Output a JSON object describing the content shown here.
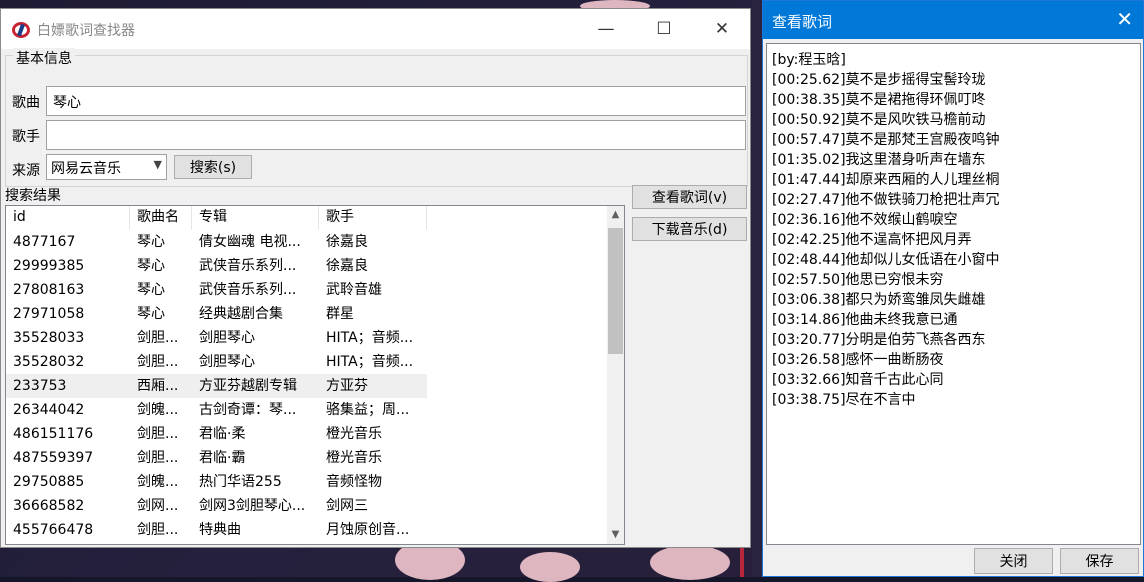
{
  "main_window": {
    "title": "白嫖歌词查找器",
    "controls": {
      "minimize": "—",
      "maximize": "☐",
      "close": "✕"
    }
  },
  "basic_info": {
    "legend": "基本信息",
    "song_label": "歌曲",
    "song_value": "琴心",
    "singer_label": "歌手",
    "singer_value": "",
    "source_label": "来源",
    "source_value": "网易云音乐",
    "search_button": "搜索(s)"
  },
  "results": {
    "label": "搜索结果",
    "columns": [
      "id",
      "歌曲名",
      "专辑",
      "歌手"
    ],
    "rows": [
      [
        "4877167",
        "琴心",
        "倩女幽魂 电视...",
        "徐嘉良"
      ],
      [
        "29999385",
        "琴心",
        "武侠音乐系列...",
        "徐嘉良"
      ],
      [
        "27808163",
        "琴心",
        "武侠音乐系列...",
        "武聆音雄"
      ],
      [
        "27971058",
        "琴心",
        "经典越剧合集",
        "群星"
      ],
      [
        "35528033",
        "剑胆...",
        "剑胆琴心",
        "HITA；音频..."
      ],
      [
        "35528032",
        "剑胆...",
        "剑胆琴心",
        "HITA；音频..."
      ],
      [
        "233753",
        "西厢...",
        "方亚芬越剧专辑",
        "方亚芬"
      ],
      [
        "26344042",
        "剑魄...",
        "古剑奇谭：琴...",
        "骆集益；周..."
      ],
      [
        "486151176",
        "剑胆...",
        "君临·柔",
        "橙光音乐"
      ],
      [
        "487559397",
        "剑胆...",
        "君临·霸",
        "橙光音乐"
      ],
      [
        "29750885",
        "剑魄...",
        "热门华语255",
        "音频怪物"
      ],
      [
        "36668582",
        "剑网...",
        "剑网3剑胆琴心...",
        "剑网三"
      ],
      [
        "455766478",
        "剑胆...",
        "特典曲",
        "月蚀原创音..."
      ]
    ],
    "selected_row": 6
  },
  "side_buttons": {
    "view_lyrics": "查看歌词(v)",
    "download_music": "下载音乐(d)"
  },
  "lyric_window": {
    "title": "查看歌词",
    "close_glyph": "✕",
    "lines": [
      "[by:程玉晗]",
      "[00:25.62]莫不是步摇得宝髻玲珑",
      "[00:38.35]莫不是裙拖得环佩叮咚",
      "[00:50.92]莫不是风吹铁马檐前动",
      "[00:57.47]莫不是那梵王宫殿夜鸣钟",
      "[01:35.02]我这里潜身听声在墙东",
      "[01:47.44]却原来西厢的人儿理丝桐",
      "[02:27.47]他不做铁骑刀枪把壮声冗",
      "[02:36.16]他不效缑山鹤唳空",
      "[02:42.25]他不逞高怀把风月弄",
      "[02:48.44]他却似儿女低语在小窗中",
      "[02:57.50]他思已穷恨未穷",
      "[03:06.38]都只为娇鸾雏凤失雌雄",
      "[03:14.86]他曲未终我意已通",
      "[03:20.77]分明是伯劳飞燕各西东",
      "[03:26.58]感怀一曲断肠夜",
      "[03:32.66]知音千古此心同",
      "[03:38.75]尽在不言中"
    ],
    "close_button": "关闭",
    "save_button": "保存"
  },
  "colors": {
    "accent": "#0078d7",
    "selection": "#e5f3fb"
  }
}
